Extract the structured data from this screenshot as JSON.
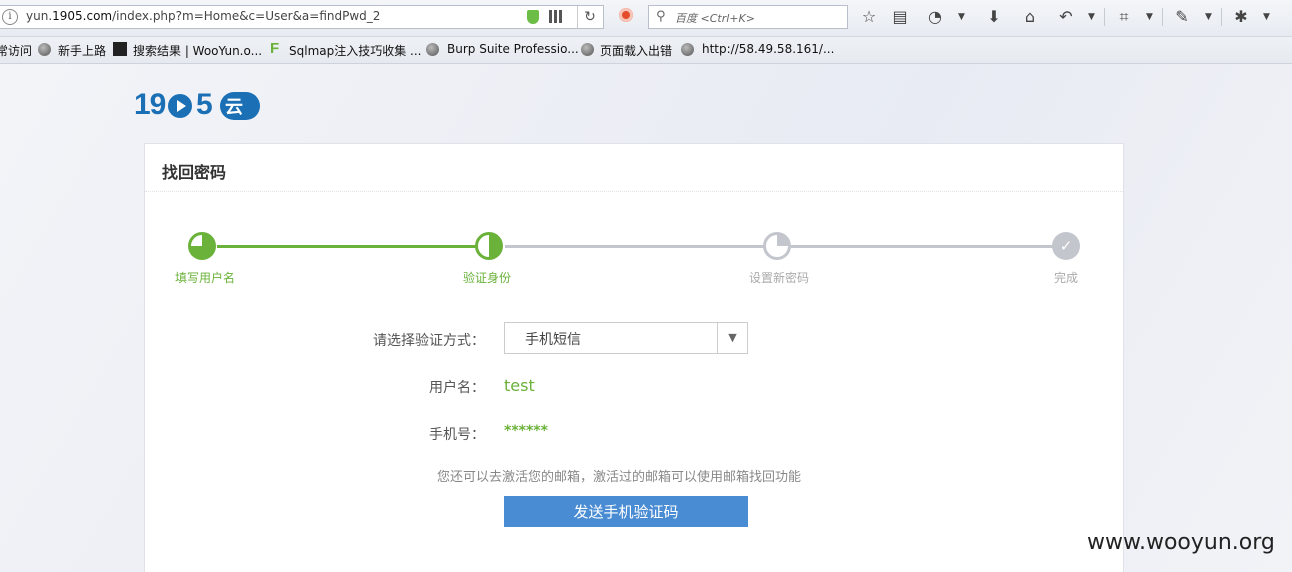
{
  "browser": {
    "url_prefix": "yun.",
    "url_domain": "1905.com",
    "url_path": "/index.php?m=Home&c=User&a=findPwd_2",
    "search_placeholder": "百度 <Ctrl+K>"
  },
  "bookmarks": [
    {
      "label": "常访问"
    },
    {
      "label": "新手上路"
    },
    {
      "label": "搜索结果 | WooYun.o..."
    },
    {
      "label": "Sqlmap注入技巧收集 ..."
    },
    {
      "label": "Burp Suite Professio..."
    },
    {
      "label": "页面载入出错"
    },
    {
      "label": "http://58.49.58.161/..."
    }
  ],
  "logo": {
    "digits_1": "19",
    "digits_2": "5",
    "cloud_text": "云"
  },
  "card": {
    "title": "找回密码"
  },
  "steps": [
    {
      "label": "填写用户名",
      "state": "done"
    },
    {
      "label": "验证身份",
      "state": "active"
    },
    {
      "label": "设置新密码",
      "state": "todo"
    },
    {
      "label": "完成",
      "state": "todo"
    }
  ],
  "form": {
    "method_label": "请选择验证方式：",
    "method_value": "手机短信",
    "username_label": "用户名：",
    "username_value": "test",
    "phone_label": "手机号：",
    "phone_value": "******",
    "hint": "您还可以去激活您的邮箱，激活过的邮箱可以使用邮箱找回功能",
    "send_button": "发送手机验证码"
  },
  "watermark": "www.wooyun.org",
  "colors": {
    "accent_green": "#6ab23a",
    "button_blue": "#4a8cd3",
    "logo_blue": "#1b6fb5",
    "step_gray": "#c3c6cc"
  }
}
